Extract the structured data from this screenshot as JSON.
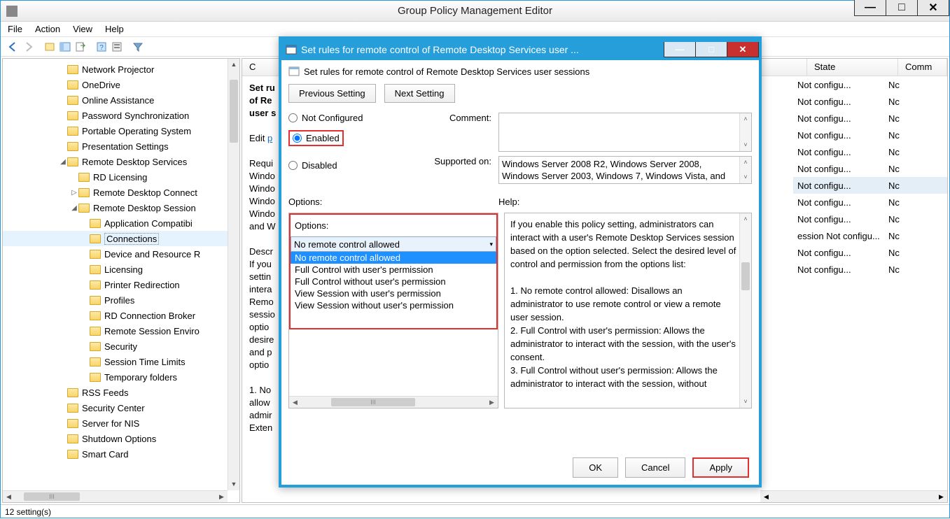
{
  "window": {
    "title": "Group Policy Management Editor",
    "status": "12 setting(s)"
  },
  "menu": {
    "file": "File",
    "action": "Action",
    "view": "View",
    "help": "Help"
  },
  "tree": {
    "items": [
      {
        "indent": 5,
        "exp": "",
        "label": "Network Projector"
      },
      {
        "indent": 5,
        "exp": "",
        "label": "OneDrive"
      },
      {
        "indent": 5,
        "exp": "",
        "label": "Online Assistance"
      },
      {
        "indent": 5,
        "exp": "",
        "label": "Password Synchronization"
      },
      {
        "indent": 5,
        "exp": "",
        "label": "Portable Operating System"
      },
      {
        "indent": 5,
        "exp": "",
        "label": "Presentation Settings"
      },
      {
        "indent": 5,
        "exp": "◢",
        "label": "Remote Desktop Services"
      },
      {
        "indent": 6,
        "exp": "",
        "label": "RD Licensing"
      },
      {
        "indent": 6,
        "exp": "▷",
        "label": "Remote Desktop Connect"
      },
      {
        "indent": 6,
        "exp": "◢",
        "label": "Remote Desktop Session"
      },
      {
        "indent": 7,
        "exp": "",
        "label": "Application Compatibi"
      },
      {
        "indent": 7,
        "exp": "",
        "label": "Connections",
        "selected": true
      },
      {
        "indent": 7,
        "exp": "",
        "label": "Device and Resource R"
      },
      {
        "indent": 7,
        "exp": "",
        "label": "Licensing"
      },
      {
        "indent": 7,
        "exp": "",
        "label": "Printer Redirection"
      },
      {
        "indent": 7,
        "exp": "",
        "label": "Profiles"
      },
      {
        "indent": 7,
        "exp": "",
        "label": "RD Connection Broker"
      },
      {
        "indent": 7,
        "exp": "",
        "label": "Remote Session Enviro"
      },
      {
        "indent": 7,
        "exp": "",
        "label": "Security"
      },
      {
        "indent": 7,
        "exp": "",
        "label": "Session Time Limits"
      },
      {
        "indent": 7,
        "exp": "",
        "label": "Temporary folders"
      },
      {
        "indent": 5,
        "exp": "",
        "label": "RSS Feeds"
      },
      {
        "indent": 5,
        "exp": "",
        "label": "Security Center"
      },
      {
        "indent": 5,
        "exp": "",
        "label": "Server for NIS"
      },
      {
        "indent": 5,
        "exp": "",
        "label": "Shutdown Options"
      },
      {
        "indent": 5,
        "exp": "",
        "label": "Smart Card"
      }
    ],
    "hscroll_label": "III"
  },
  "details": {
    "col_state": "State",
    "col_comm": "Comm",
    "title_frag": "Set ru\nof Re\nuser s",
    "edit_prefix": "Edit ",
    "edit_link": "p",
    "req_lines": "Requi\nWindo\nWindo\nWindo\nWindo\nand W",
    "desc_lines": "Descr\nIf you\nsettin\nintera\nRemo\nsessio\noptio\ndesire\nand p\noptio",
    "list_lines": "1. No\nallow\nadmir\nExten",
    "rows": [
      {
        "state": "Not configu...",
        "comm": "Nc"
      },
      {
        "state": "Not configu...",
        "comm": "Nc"
      },
      {
        "state": "Not configu...",
        "comm": "Nc"
      },
      {
        "state": "Not configu...",
        "comm": "Nc"
      },
      {
        "state": "Not configu...",
        "comm": "Nc"
      },
      {
        "state": "Not configu...",
        "comm": "Nc"
      },
      {
        "state": "Not configu...",
        "comm": "Nc",
        "sel": true
      },
      {
        "state": "Not configu...",
        "comm": "Nc"
      },
      {
        "state": "Not configu...",
        "comm": "Nc"
      },
      {
        "state": "ession   Not configu...",
        "comm": "Nc"
      },
      {
        "state": "Not configu...",
        "comm": "Nc"
      },
      {
        "state": "Not configu...",
        "comm": "Nc"
      }
    ]
  },
  "dialog": {
    "title": "Set rules for remote control of Remote Desktop Services user ...",
    "subtitle": "Set rules for remote control of Remote Desktop Services user sessions",
    "prev": "Previous Setting",
    "next": "Next Setting",
    "radio_not": "Not Configured",
    "radio_enabled": "Enabled",
    "radio_disabled": "Disabled",
    "comment_label": "Comment:",
    "supported_label": "Supported on:",
    "supported_text": "Windows Server 2008 R2, Windows Server 2008, Windows Server 2003, Windows 7, Windows Vista, and",
    "options_label": "Options:",
    "help_label": "Help:",
    "options_header": "Options:",
    "combo_value": "No remote control allowed",
    "dropdown": [
      "No remote control allowed",
      "Full Control with user's permission",
      "Full Control without user's permission",
      "View Session with user's permission",
      "View Session without user's permission"
    ],
    "opt_hscroll_label": "III",
    "help_text": "If you enable this policy setting, administrators can interact with a user's Remote Desktop Services session based on the option selected. Select the desired level of control and permission from the options list:\n\n1. No remote control allowed: Disallows an administrator to use remote control or view a remote user session.\n2. Full Control with user's permission: Allows the administrator to interact with the session, with the user's consent.\n3. Full Control without user's permission: Allows the administrator to interact with the session, without",
    "ok": "OK",
    "cancel": "Cancel",
    "apply": "Apply"
  }
}
